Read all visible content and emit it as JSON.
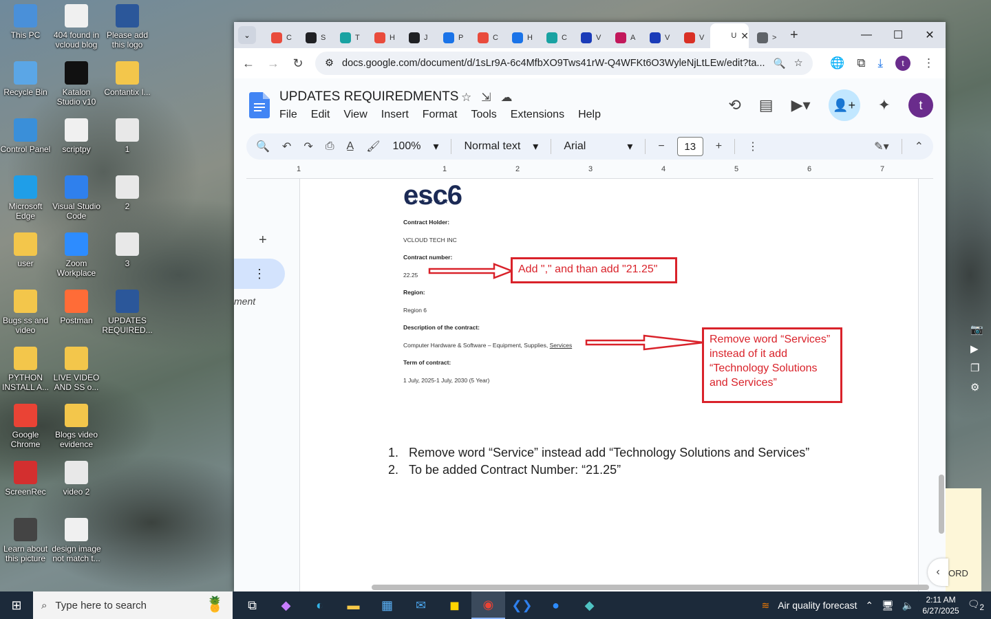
{
  "desktop": {
    "icons": [
      {
        "label": "This PC",
        "icon": "pc-icon"
      },
      {
        "label": "404 found in vcloud blog",
        "icon": "document-icon"
      },
      {
        "label": "Please add this logo",
        "icon": "word-icon"
      },
      {
        "label": "Recycle Bin",
        "icon": "recycle-icon"
      },
      {
        "label": "Katalon Studio v10",
        "icon": "katalon-icon"
      },
      {
        "label": "Contantix I...",
        "icon": "folder-icon"
      },
      {
        "label": "Control Panel",
        "icon": "control-panel-icon"
      },
      {
        "label": "scriptpy",
        "icon": "document-icon"
      },
      {
        "label": "1",
        "icon": "image-icon"
      },
      {
        "label": "Microsoft Edge",
        "icon": "edge-icon"
      },
      {
        "label": "Visual Studio Code",
        "icon": "vscode-icon"
      },
      {
        "label": "2",
        "icon": "image-icon"
      },
      {
        "label": "user",
        "icon": "folder-icon"
      },
      {
        "label": "Zoom Workplace",
        "icon": "zoom-icon"
      },
      {
        "label": "3",
        "icon": "image-icon"
      },
      {
        "label": "Bugs ss and video",
        "icon": "folder-icon"
      },
      {
        "label": "Postman",
        "icon": "postman-icon"
      },
      {
        "label": "UPDATES REQUIRED...",
        "icon": "word-icon"
      },
      {
        "label": "PYTHON INSTALL A...",
        "icon": "folder-icon"
      },
      {
        "label": "LIVE VIDEO AND SS o...",
        "icon": "folder-icon"
      },
      {
        "label": "Google Chrome",
        "icon": "chrome-icon"
      },
      {
        "label": "Blogs video evidence",
        "icon": "folder-icon"
      },
      {
        "label": "ScreenRec",
        "icon": "screenrec-icon"
      },
      {
        "label": "video 2",
        "icon": "video-icon"
      },
      {
        "label": "Learn about this picture",
        "icon": "info-icon"
      },
      {
        "label": "design image not match t...",
        "icon": "document-icon"
      }
    ]
  },
  "browser": {
    "tabs": [
      {
        "label": "C",
        "color": "#e94b3c"
      },
      {
        "label": "S",
        "color": "#202124"
      },
      {
        "label": "T",
        "color": "#19a2a2"
      },
      {
        "label": "H",
        "color": "#e94b3c"
      },
      {
        "label": "J",
        "color": "#202124"
      },
      {
        "label": "P",
        "color": "#1a73e8"
      },
      {
        "label": "C",
        "color": "#e94b3c"
      },
      {
        "label": "H",
        "color": "#1a73e8"
      },
      {
        "label": "C",
        "color": "#19a2a2"
      },
      {
        "label": "V",
        "color": "#1a3bb8"
      },
      {
        "label": "A",
        "color": "#c2185b"
      },
      {
        "label": "V",
        "color": "#1a3bb8"
      },
      {
        "label": "V",
        "color": "#d93025"
      },
      {
        "label": "U",
        "color": "#ffffff",
        "active": true
      },
      {
        "label": ">",
        "color": "#5f6368"
      }
    ],
    "url": "docs.google.com/document/d/1sLr9A-6c4MfbXO9Tws41rW-Q4WFKt6O3WyleNjLtLEw/edit?ta...",
    "profile_initial": "t"
  },
  "docs": {
    "title": "UPDATES REQUIREDMENTS",
    "menu": [
      "File",
      "Edit",
      "View",
      "Insert",
      "Format",
      "Tools",
      "Extensions",
      "Help"
    ],
    "toolbar": {
      "zoom": "100%",
      "style": "Normal text",
      "font": "Arial",
      "font_size": "13"
    },
    "user_initial": "t",
    "ruler_numbers": [
      "1",
      "1",
      "2",
      "3",
      "4",
      "5",
      "6",
      "7"
    ],
    "side_fragment": "ment",
    "pasted_image": {
      "logo": "esc6",
      "stars": "★★★★★★",
      "contract_holder_label": "Contract Holder:",
      "contract_holder": "VCLOUD TECH INC",
      "contract_number_label": "Contract number:",
      "contract_number": "22.25",
      "region_label": "Region:",
      "region": "Region 6",
      "description_label": "Description of the contract:",
      "description": "Computer Hardware & Software – Equipment, Supplies, ",
      "description_underlined": "Services",
      "term_label": "Term of contract:",
      "term": "1 July, 2025-1 July, 2030 (5 Year)",
      "callout1": "Add \",\" and than add \"21.25\"",
      "callout2": "Remove word “Services” instead of it add “Technology Solutions and Services”"
    },
    "list": [
      {
        "num": "1.",
        "text": "Remove word “Service” instead add “Technology Solutions and Services”"
      },
      {
        "num": "2.",
        "text": "To be added Contract Number: “21.25”"
      }
    ]
  },
  "right_edge_text": "ORD",
  "taskbar": {
    "search_placeholder": "Type here to search",
    "weather": "Air quality forecast",
    "time": "2:11 AM",
    "date": "6/27/2025",
    "notifications": "2"
  }
}
